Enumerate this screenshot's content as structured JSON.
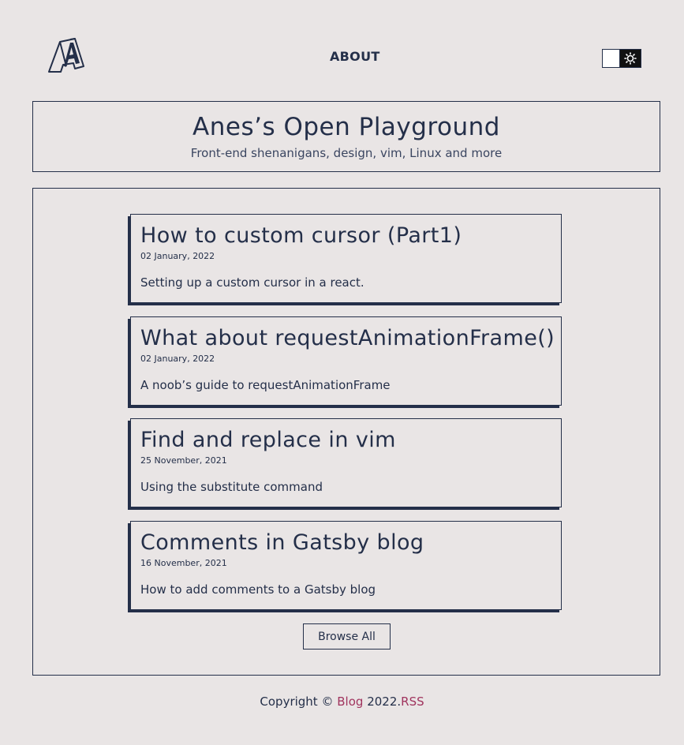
{
  "header": {
    "nav_about": "ABOUT",
    "logo_icon": "letter-a-logo-icon",
    "theme_toggle_icon": "sun-icon"
  },
  "banner": {
    "title": "Anes’s Open Playground",
    "subtitle": "Front-end shenanigans, design, vim, Linux and more"
  },
  "posts": [
    {
      "title": "How to custom cursor (Part1)",
      "date": "02 January, 2022",
      "description": "Setting up a custom cursor in a react."
    },
    {
      "title": "What about requestAnimationFrame()",
      "date": "02 January, 2022",
      "description": "A noob’s guide to requestAnimationFrame"
    },
    {
      "title": "Find and replace in vim",
      "date": "25 November, 2021",
      "description": "Using the substitute command"
    },
    {
      "title": "Comments in Gatsby blog",
      "date": "16 November, 2021",
      "description": "How to add comments to a Gatsby blog"
    }
  ],
  "browse_label": "Browse All",
  "footer": {
    "copyright_prefix": "Copyright ©",
    "blog_link": "Blog",
    "year": "2022.",
    "rss_link": "RSS"
  },
  "colors": {
    "background": "#e9e5e5",
    "text": "#242f49",
    "link": "#a0345e"
  }
}
